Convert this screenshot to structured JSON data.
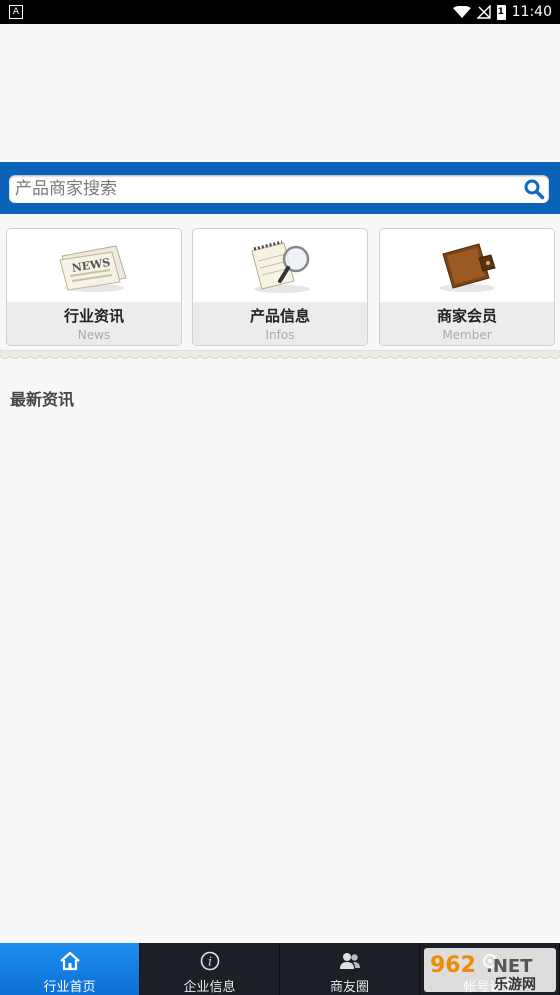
{
  "status_bar": {
    "left_icon_letter": "A",
    "time": "11:40",
    "battery_label": "1"
  },
  "search": {
    "placeholder": "产品商家搜索"
  },
  "cards": [
    {
      "title": "行业资讯",
      "subtitle": "News",
      "icon": "newspaper-icon"
    },
    {
      "title": "产品信息",
      "subtitle": "Infos",
      "icon": "notebook-magnifier-icon"
    },
    {
      "title": "商家会员",
      "subtitle": "Member",
      "icon": "wallet-icon"
    }
  ],
  "section": {
    "title": "最新资讯"
  },
  "tabs": [
    {
      "label": "行业首页",
      "icon": "home-icon",
      "active": true
    },
    {
      "label": "企业信息",
      "icon": "info-icon",
      "active": false
    },
    {
      "label": "商友圈",
      "icon": "users-icon",
      "active": false
    },
    {
      "label": "帐号设置",
      "icon": "settings-icon",
      "active": false
    }
  ],
  "watermark": {
    "brand": "962",
    "suffix": ".NET",
    "sub": "乐游网"
  },
  "colors": {
    "search_bar": "#0a63b8",
    "tab_active": "#1f8ff0",
    "tab_bar": "#1c1f26"
  }
}
